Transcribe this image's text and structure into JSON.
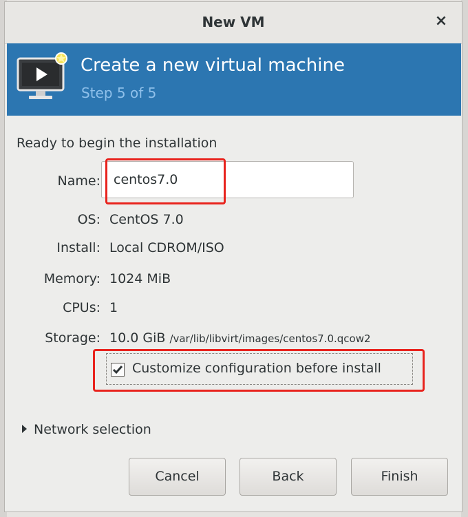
{
  "window": {
    "title": "New VM",
    "close_glyph": "×"
  },
  "banner": {
    "title": "Create a new virtual machine",
    "step": "Step 5 of 5",
    "icon": "monitor-new-vm-icon"
  },
  "summary": {
    "heading": "Ready to begin the installation",
    "name_label": "Name:",
    "name_value": "centos7.0",
    "os_label": "OS:",
    "os_value": "CentOS 7.0",
    "install_label": "Install:",
    "install_value": "Local CDROM/ISO",
    "memory_label": "Memory:",
    "memory_value": "1024 MiB",
    "cpus_label": "CPUs:",
    "cpus_value": "1",
    "storage_label": "Storage:",
    "storage_size": "10.0 GiB",
    "storage_path": "/var/lib/libvirt/images/centos7.0.qcow2"
  },
  "customize": {
    "label": "Customize configuration before install",
    "checked": true
  },
  "network": {
    "label": "Network selection"
  },
  "buttons": {
    "cancel": "Cancel",
    "back": "Back",
    "finish": "Finish"
  },
  "colors": {
    "banner": "#2c76b1",
    "highlight": "#e8231d",
    "step_text": "#8fc0ea"
  }
}
